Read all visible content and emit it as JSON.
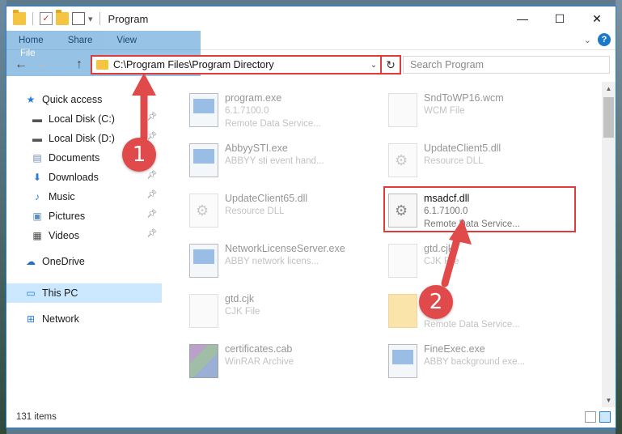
{
  "window": {
    "title": "Program",
    "controls": {
      "minimize": "—",
      "maximize": "☐",
      "close": "✕"
    }
  },
  "ribbon": {
    "tabs": [
      {
        "label": "File"
      },
      {
        "label": "Home"
      },
      {
        "label": "Share"
      },
      {
        "label": "View"
      }
    ]
  },
  "address": {
    "path": "C:\\Program Files\\Program Directory",
    "search_placeholder": "Search Program"
  },
  "navpane": {
    "items": [
      {
        "label": "Quick access",
        "icon": "star-icon"
      },
      {
        "label": "Local Disk (C:)",
        "icon": "drive-icon",
        "pinned": true
      },
      {
        "label": "Local Disk (D:)",
        "icon": "drive-icon",
        "pinned": true
      },
      {
        "label": "Documents",
        "icon": "documents-icon",
        "pinned": true
      },
      {
        "label": "Downloads",
        "icon": "download-icon",
        "pinned": true
      },
      {
        "label": "Music",
        "icon": "music-icon",
        "pinned": true
      },
      {
        "label": "Pictures",
        "icon": "pictures-icon",
        "pinned": true
      },
      {
        "label": "Videos",
        "icon": "videos-icon",
        "pinned": true
      },
      {
        "label": "OneDrive",
        "icon": "cloud-icon"
      },
      {
        "label": "This PC",
        "icon": "computer-icon",
        "selected": true
      },
      {
        "label": "Network",
        "icon": "network-icon"
      }
    ]
  },
  "files": [
    {
      "name": "program.exe",
      "line1": "6.1.7100.0",
      "line2": "Remote Data Service...",
      "icon": "exe-icon"
    },
    {
      "name": "SndToWP16.wcm",
      "line1": "WCM File",
      "line2": "",
      "icon": "document-icon"
    },
    {
      "name": "AbbyySTI.exe",
      "line1": "ABBYY sti event hand...",
      "line2": "",
      "icon": "exe-icon"
    },
    {
      "name": "UpdateClient5.dll",
      "line1": "Resource DLL",
      "line2": "",
      "icon": "dll-icon"
    },
    {
      "name": "UpdateClient65.dll",
      "line1": "Resource DLL",
      "line2": "",
      "icon": "dll-icon"
    },
    {
      "name": "msadcf.dll",
      "line1": "6.1.7100.0",
      "line2": "Remote Data Service...",
      "icon": "dll-icon",
      "highlighted": true
    },
    {
      "name": "NetworkLicenseServer.exe",
      "line1": "ABBY network licens...",
      "line2": "",
      "icon": "exe-icon"
    },
    {
      "name": "gtd.cjk",
      "line1": "CJK File",
      "line2": "",
      "icon": "document-icon"
    },
    {
      "name": "gtd.cjk",
      "line1": "CJK File",
      "line2": "",
      "icon": "document-icon"
    },
    {
      "name": "",
      "line1": "",
      "line2": "Remote Data Service...",
      "icon": "folder-icon"
    },
    {
      "name": "certificates.cab",
      "line1": "WinRAR Archive",
      "line2": "",
      "icon": "archive-icon"
    },
    {
      "name": "FineExec.exe",
      "line1": "ABBY background exe...",
      "line2": "",
      "icon": "exe-icon"
    }
  ],
  "status": {
    "item_count": "131 items"
  },
  "annotations": {
    "step1": "1",
    "step2": "2"
  },
  "colors": {
    "accent": "#1979ca",
    "annotation": "#e03a3a"
  }
}
